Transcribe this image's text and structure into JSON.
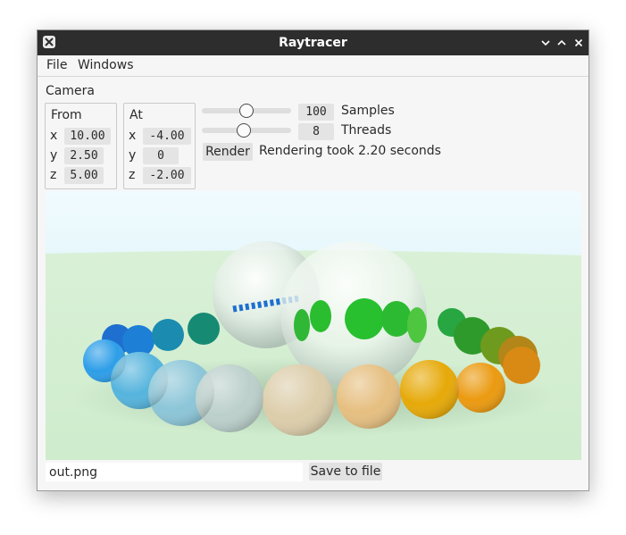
{
  "window": {
    "title": "Raytracer",
    "controls": {
      "close_left": "close-icon",
      "minimize": "chevron-down-icon",
      "maximize": "chevron-up-icon",
      "close": "close-icon"
    }
  },
  "menu": {
    "items": [
      "File",
      "Windows"
    ]
  },
  "camera": {
    "label": "Camera",
    "from": {
      "title": "From",
      "x": "10.00",
      "y": "2.50",
      "z": "5.00"
    },
    "at": {
      "title": "At",
      "x": "-4.00",
      "y": "0",
      "z": "-2.00"
    },
    "axis_labels": [
      "x",
      "y",
      "z"
    ]
  },
  "render": {
    "samples": {
      "value": "100",
      "label": "Samples",
      "slider_fraction": 0.5
    },
    "threads": {
      "value": "8",
      "label": "Threads",
      "slider_fraction": 0.47
    },
    "button_label": "Render",
    "status": "Rendering took 2.20 seconds"
  },
  "output": {
    "filename": "out.png",
    "save_label": "Save to file"
  },
  "colors": {
    "titlebar": "#2d2d2d",
    "window_bg": "#f6f6f6",
    "sky": "#eefaff",
    "ground": "#d4eed2"
  }
}
